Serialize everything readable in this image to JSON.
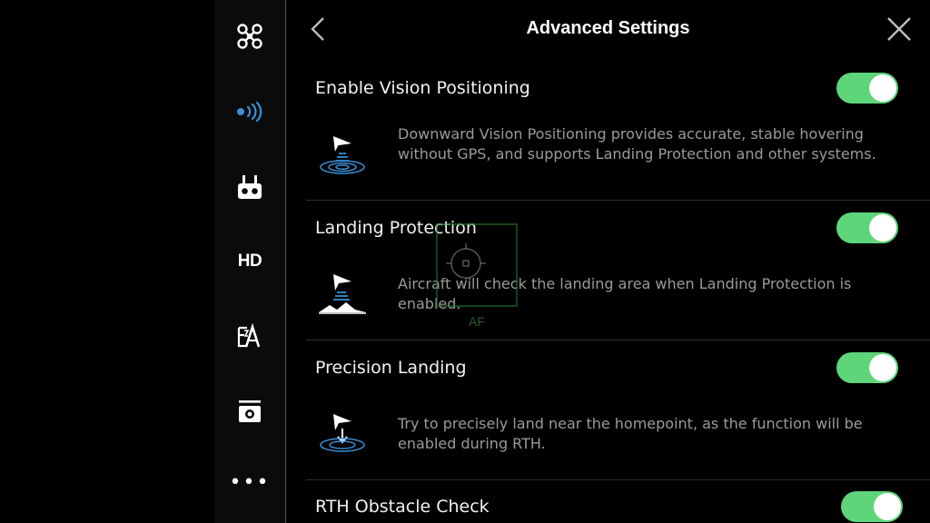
{
  "header": {
    "title": "Advanced Settings",
    "back_icon": "chevron-left-icon",
    "close_icon": "close-icon"
  },
  "sidebar": {
    "items": [
      {
        "name": "aircraft",
        "icon": "drone-icon"
      },
      {
        "name": "signal",
        "icon": "signal-waves-icon"
      },
      {
        "name": "remote-controller",
        "icon": "remote-controller-icon"
      },
      {
        "name": "hd",
        "label": "HD"
      },
      {
        "name": "battery",
        "icon": "battery-icon"
      },
      {
        "name": "camera",
        "icon": "camera-icon"
      },
      {
        "name": "more",
        "label": "•••"
      }
    ],
    "active_color": "#3a8fd8"
  },
  "sections": [
    {
      "title": "Enable Vision Positioning",
      "description": "Downward Vision Positioning provides accurate, stable hovering without GPS, and supports Landing Protection and other systems.",
      "enabled": true,
      "icon": "vision-positioning-icon"
    },
    {
      "title": "Landing Protection",
      "description": "Aircraft will check the landing area when Landing Protection is enabled.",
      "enabled": true,
      "icon": "landing-protection-icon"
    },
    {
      "title": "Precision Landing",
      "description": "Try to precisely land near the homepoint, as the function will be enabled during RTH.",
      "enabled": true,
      "icon": "precision-landing-icon"
    },
    {
      "title": "RTH Obstacle Check",
      "enabled": true
    }
  ],
  "overlay": {
    "af_label": "AF"
  },
  "colors": {
    "toggle_on": "#5fd57a",
    "accent_blue": "#3a8fd8"
  }
}
